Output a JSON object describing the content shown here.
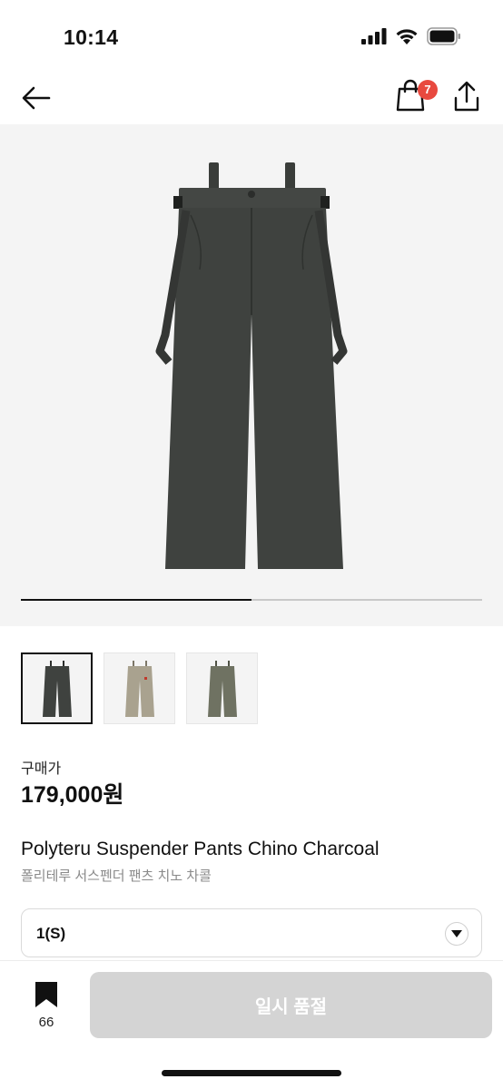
{
  "status_bar": {
    "time": "10:14"
  },
  "nav": {
    "cart_count": "7"
  },
  "gallery": {
    "image_count": 2,
    "current_index": 1,
    "progress_fraction": 0.5
  },
  "thumbnails": [
    {
      "name": "charcoal",
      "color": "#3f423f",
      "selected": true
    },
    {
      "name": "beige",
      "color": "#a9a28f",
      "selected": false
    },
    {
      "name": "khaki",
      "color": "#6f7262",
      "selected": false
    }
  ],
  "product": {
    "price_label": "구매가",
    "price": "179,000원",
    "title_en": "Polyteru Suspender Pants Chino Charcoal",
    "title_ko": "폴리테루 서스펜더 팬츠 치노 차콜"
  },
  "size_select": {
    "value": "1(S)"
  },
  "bottom_bar": {
    "bookmark_count": "66",
    "action_label": "일시 품절"
  },
  "colors": {
    "badge": "#e8493f",
    "disabled_button": "#d4d4d4",
    "product": "#3f423f"
  },
  "icons": [
    "back-arrow-icon",
    "shopping-bag-icon",
    "share-icon",
    "bookmark-icon",
    "chevron-down-icon"
  ]
}
